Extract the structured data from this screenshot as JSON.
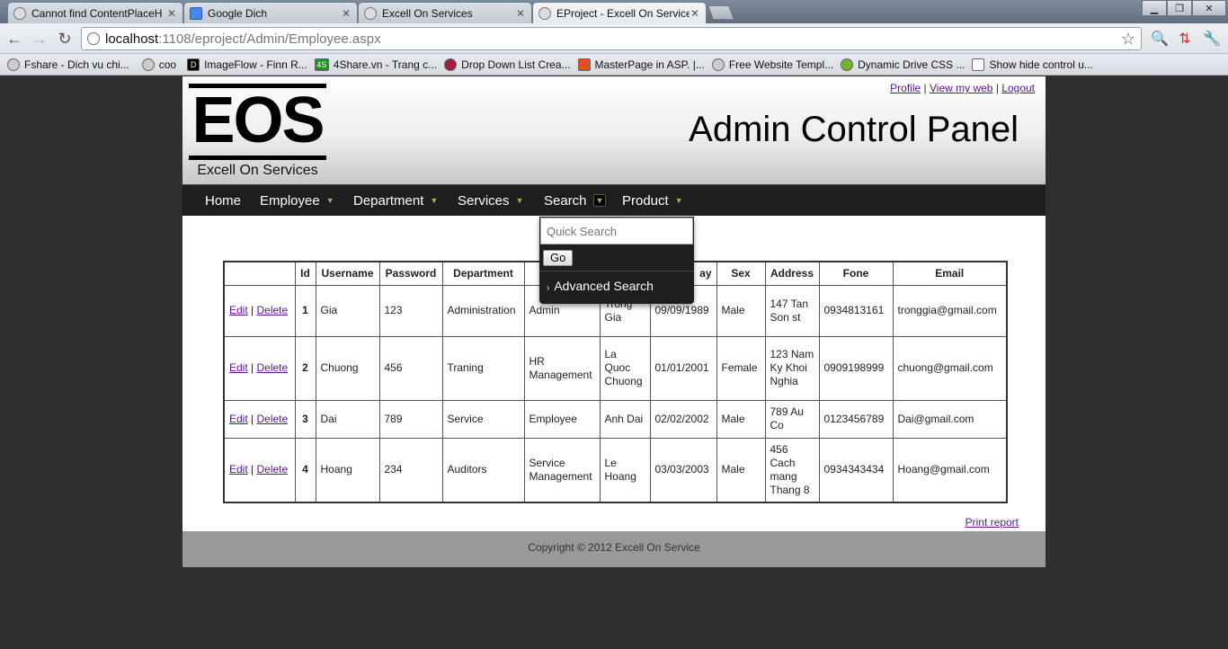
{
  "browser": {
    "tabs": [
      {
        "title": "Cannot find ContentPlaceH",
        "active": false
      },
      {
        "title": "Google Dich",
        "active": false
      },
      {
        "title": "Excell On Services",
        "active": false
      },
      {
        "title": "EProject - Excell On Service",
        "active": true
      }
    ],
    "url_host": "localhost",
    "url_path": ":1108/eproject/Admin/Employee.aspx",
    "bookmarks": [
      "Fshare - Dich vu chi...",
      "coo",
      "ImageFlow - Finn R...",
      "4Share.vn - Trang c...",
      "Drop Down List Crea...",
      "MasterPage in ASP. |...",
      "Free Website Templ...",
      "Dynamic Drive CSS ...",
      "Show hide control u..."
    ]
  },
  "header": {
    "logo_text": "EOS",
    "logo_tagline": "Excell On Services",
    "links": {
      "profile": "Profile",
      "view_web": "View my web",
      "logout": "Logout",
      "separator": "|"
    },
    "title": "Admin Control Panel"
  },
  "menu": {
    "home": "Home",
    "employee": "Employee",
    "department": "Department",
    "services": "Services",
    "search": "Search",
    "product": "Product"
  },
  "search_dropdown": {
    "placeholder": "Quick Search",
    "go_label": "Go",
    "advanced_label": "Advanced Search"
  },
  "table": {
    "headers": [
      "",
      "Id",
      "Username",
      "Password",
      "Department",
      "",
      "",
      "ay",
      "Sex",
      "Address",
      "Fone",
      "Email"
    ],
    "edit_label": "Edit",
    "delete_label": "Delete",
    "sep": "|",
    "rows": [
      {
        "id": "1",
        "username": "Gia",
        "password": "123",
        "department": "Administration",
        "position": "Admin",
        "name": "Trong Gia",
        "birthday": "09/09/1989",
        "sex": "Male",
        "address": "147 Tan Son st",
        "fone": "0934813161",
        "email": "tronggia@gmail.com"
      },
      {
        "id": "2",
        "username": "Chuong",
        "password": "456",
        "department": "Traning",
        "position": "HR Management",
        "name": "La Quoc Chuong",
        "birthday": "01/01/2001",
        "sex": "Female",
        "address": "123 Nam Ky Khoi Nghia",
        "fone": "0909198999",
        "email": "chuong@gmail.com"
      },
      {
        "id": "3",
        "username": "Dai",
        "password": "789",
        "department": "Service",
        "position": "Employee",
        "name": "Anh Dai",
        "birthday": "02/02/2002",
        "sex": "Male",
        "address": "789 Au Co",
        "fone": "0123456789",
        "email": "Dai@gmail.com"
      },
      {
        "id": "4",
        "username": "Hoang",
        "password": "234",
        "department": "Auditors",
        "position": "Service Management",
        "name": "Le Hoang",
        "birthday": "03/03/2003",
        "sex": "Male",
        "address": "456 Cach mang Thang 8",
        "fone": "0934343434",
        "email": "Hoang@gmail.com"
      }
    ]
  },
  "print_label": "Print report",
  "footer_text": "Copyright © 2012 Excell On Service",
  "colors": {
    "menu_bg": "#1e1e1e",
    "menu_arrow": "#8fbf3f",
    "link": "#551a8b",
    "footer_bg": "#999999",
    "body_bg": "#2f2f2f"
  }
}
